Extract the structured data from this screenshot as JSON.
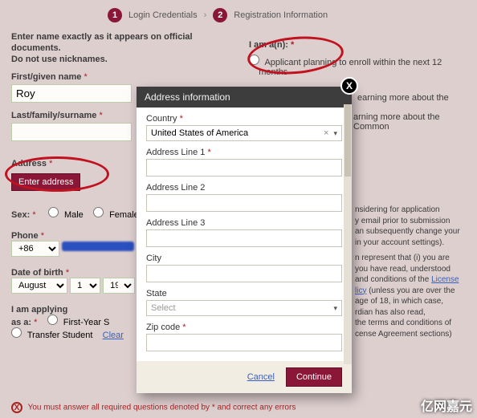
{
  "steps": {
    "s1_label": "Login Credentials",
    "s2_label": "Registration Information"
  },
  "instructions": {
    "line1": "Enter name exactly as it appears on official",
    "line2": "documents.",
    "line3": "Do not use nicknames."
  },
  "form": {
    "first_label": "First/given name",
    "first_value": "Roy",
    "last_label": "Last/family/surname",
    "address_label": "Address",
    "enter_address_btn": "Enter address",
    "sex_label": "Sex:",
    "sex_male": "Male",
    "sex_female": "Female",
    "phone_label": "Phone",
    "phone_cc": "+86",
    "dob_label": "Date of birth",
    "dob_month": "August",
    "dob_day": "1",
    "dob_year": "19",
    "apply_label": "I am applying",
    "apply_as": "as a:",
    "apply_first_year": "First-Year S",
    "apply_transfer": "Transfer Student",
    "clear": "Clear"
  },
  "iam": {
    "label": "I am a(n):",
    "opt1a": "Applicant planning to enroll within the next 12",
    "opt1b": "months",
    "opt2_tail": "earning more about the",
    "opt3_tail": "arning more about the Common"
  },
  "agreement": {
    "l1": "nsidering for application",
    "l2": "y email prior to submission",
    "l3": "an subsequently change your",
    "l4": "in your account settings).",
    "l5": "n represent that (i) you are",
    "l6": "you have read, understood",
    "l7": "and conditions of the ",
    "l7_link": "License",
    "l8_link": "licy",
    "l8": " (unless you are over the",
    "l9": "age of 18, in which case,",
    "l10": "rdian has also read,",
    "l11": "the terms and conditions of",
    "l12": "cense Agreement sections)"
  },
  "error": {
    "text": "You must answer all required questions denoted by * and correct any errors"
  },
  "modal": {
    "title": "Address information",
    "country_label": "Country",
    "country_value": "United States of America",
    "addr1_label": "Address Line 1",
    "addr2_label": "Address Line 2",
    "addr3_label": "Address Line 3",
    "city_label": "City",
    "state_label": "State",
    "state_placeholder": "Select",
    "zip_label": "Zip code",
    "cancel": "Cancel",
    "continue": "Continue"
  },
  "branding": "亿网嘉元",
  "glyph": {
    "star": "*",
    "times": "×",
    "caret": "▾",
    "arrow": "›",
    "x": "X"
  }
}
